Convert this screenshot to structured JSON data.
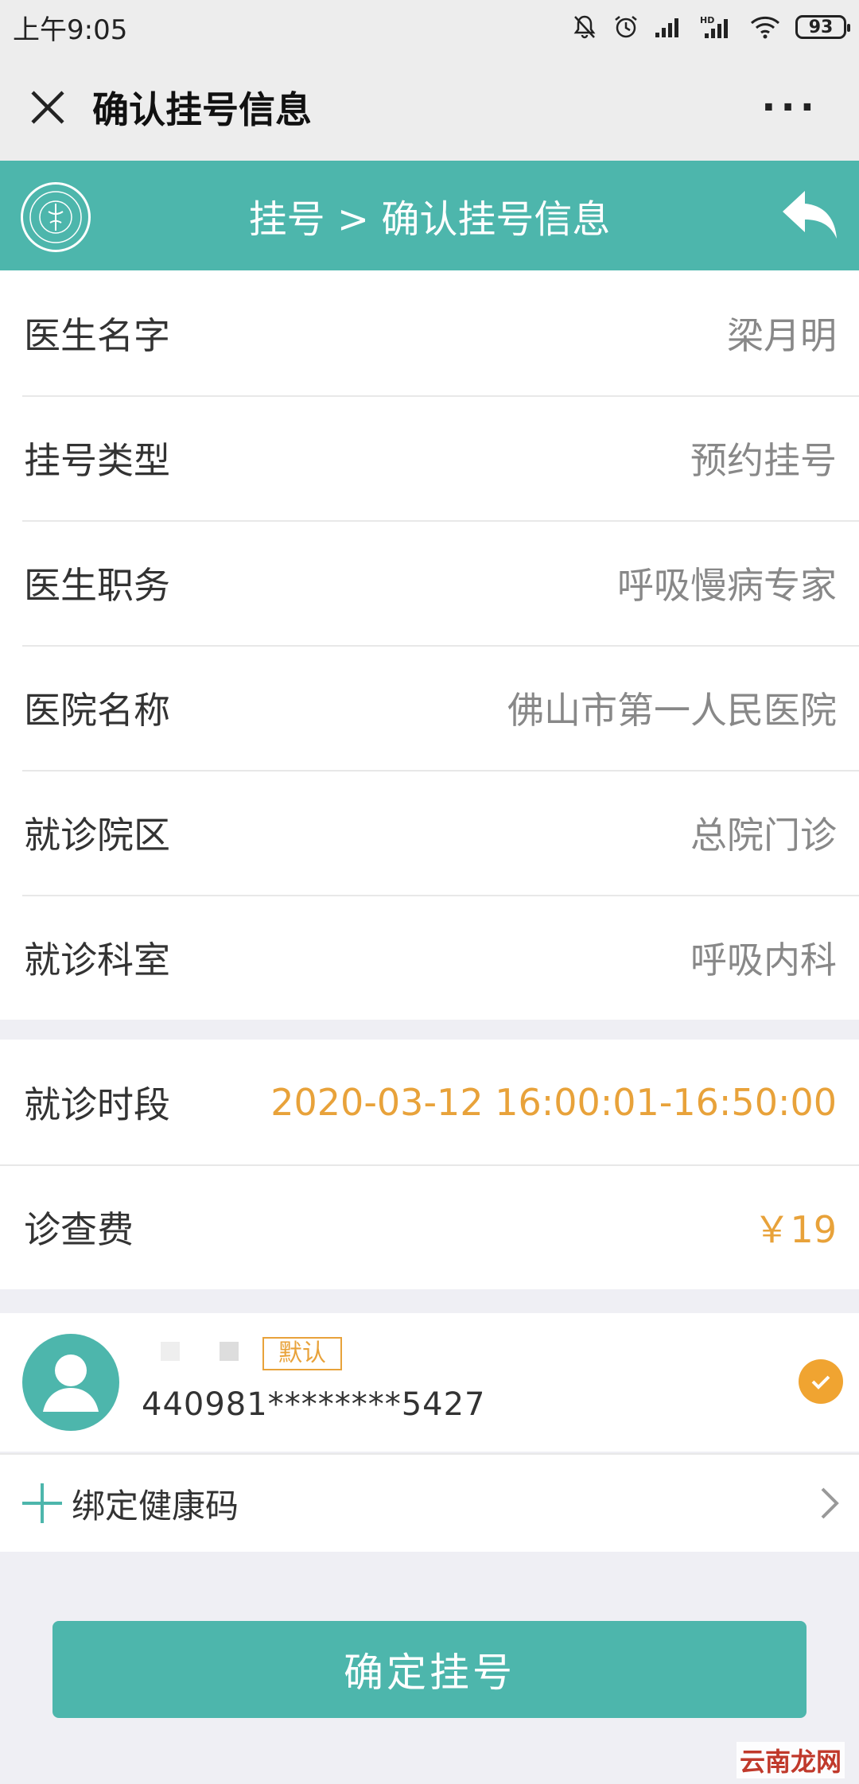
{
  "status_bar": {
    "time": "上午9:05",
    "battery": "93",
    "icons": [
      "mute-icon",
      "alarm-icon",
      "signal-icon",
      "hd-signal-icon",
      "wifi-icon",
      "battery-icon"
    ]
  },
  "title_bar": {
    "title": "确认挂号信息",
    "close_icon": "close-icon",
    "more_icon": "more-icon",
    "more_glyph": "···"
  },
  "header": {
    "breadcrumb": "挂号 > 确认挂号信息",
    "back_icon": "back-arrow-icon",
    "accent_color": "#4db6ac"
  },
  "info_rows": [
    {
      "label": "医生名字",
      "value": "梁月明"
    },
    {
      "label": "挂号类型",
      "value": "预约挂号"
    },
    {
      "label": "医生职务",
      "value": "呼吸慢病专家"
    },
    {
      "label": "医院名称",
      "value": "佛山市第一人民医院"
    },
    {
      "label": "就诊院区",
      "value": "总院门诊"
    },
    {
      "label": "就诊科室",
      "value": "呼吸内科"
    }
  ],
  "fee_rows": [
    {
      "label": "就诊时段",
      "value": "2020-03-12 16:00:01-16:50:00"
    },
    {
      "label": "诊查费",
      "value": "￥19"
    }
  ],
  "highlight_color": "#e8a23a",
  "patient": {
    "default_badge": "默认",
    "id_number": "440981********5427",
    "selected": true
  },
  "bind_health_code": {
    "label": "绑定健康码"
  },
  "confirm_button": {
    "label": "确定挂号"
  },
  "watermark": "云南龙网"
}
